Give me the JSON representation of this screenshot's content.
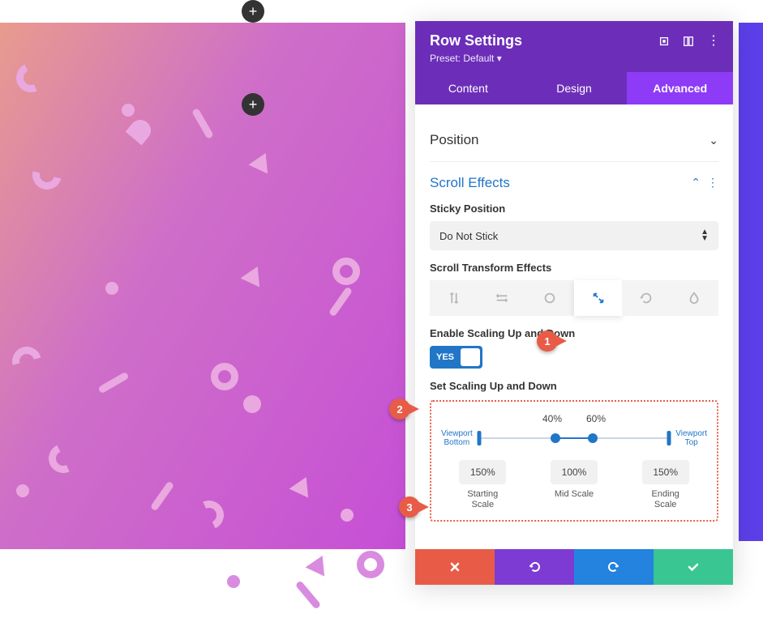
{
  "header": {
    "title": "Row Settings",
    "preset": "Preset: Default ▾"
  },
  "tabs": {
    "content": "Content",
    "design": "Design",
    "advanced": "Advanced"
  },
  "sections": {
    "position": "Position",
    "scrollEffects": "Scroll Effects"
  },
  "stickyPosition": {
    "label": "Sticky Position",
    "value": "Do Not Stick"
  },
  "scrollTransform": {
    "label": "Scroll Transform Effects"
  },
  "enableScaling": {
    "label": "Enable Scaling Up and Down",
    "toggleText": "YES"
  },
  "setScaling": {
    "label": "Set Scaling Up and Down",
    "trackLabels": {
      "mid1": "40%",
      "mid2": "60%"
    },
    "viewportBottom": "Viewport\nBottom",
    "viewportTop": "Viewport\nTop",
    "inputs": {
      "start": {
        "value": "150%",
        "caption": "Starting\nScale"
      },
      "mid": {
        "value": "100%",
        "caption": "Mid Scale"
      },
      "end": {
        "value": "150%",
        "caption": "Ending\nScale"
      }
    }
  },
  "annotations": {
    "a1": "1",
    "a2": "2",
    "a3": "3"
  }
}
